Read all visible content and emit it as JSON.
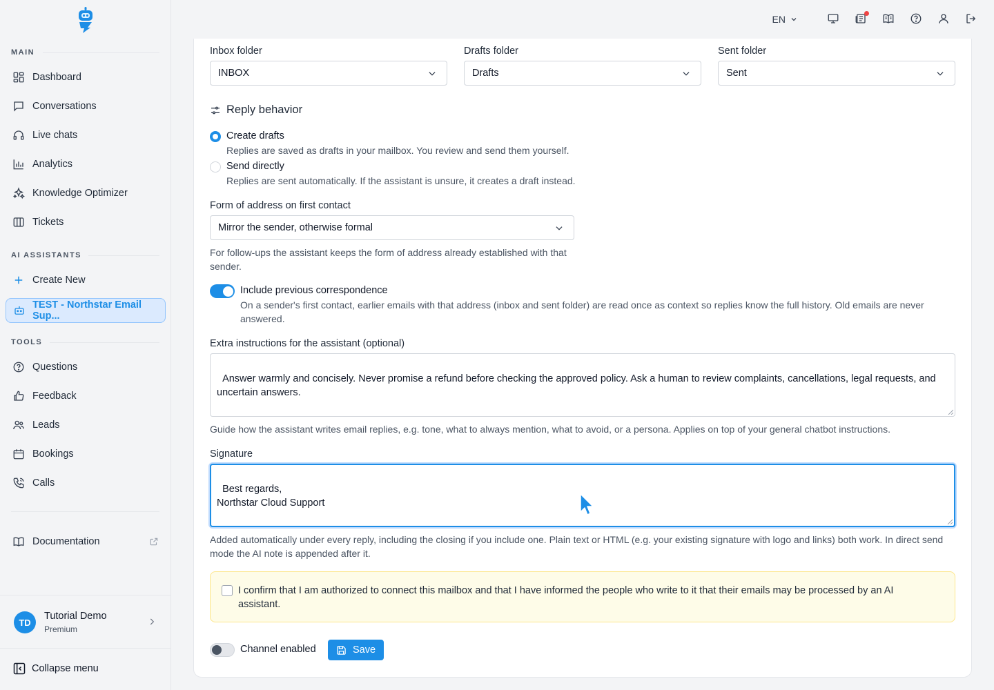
{
  "sidebar": {
    "main_label": "MAIN",
    "main_items": [
      {
        "label": "Dashboard",
        "icon": "dashboard-icon"
      },
      {
        "label": "Conversations",
        "icon": "chat-icon"
      },
      {
        "label": "Live chats",
        "icon": "headset-icon"
      },
      {
        "label": "Analytics",
        "icon": "bar-chart-icon"
      },
      {
        "label": "Knowledge Optimizer",
        "icon": "sparkles-icon"
      },
      {
        "label": "Tickets",
        "icon": "columns-icon"
      }
    ],
    "assistants_label": "AI ASSISTANTS",
    "create_new": "Create New",
    "active_assistant": "TEST - Northstar Email Sup...",
    "tools_label": "TOOLS",
    "tools_items": [
      {
        "label": "Questions",
        "icon": "question-icon"
      },
      {
        "label": "Feedback",
        "icon": "thumbs-up-icon"
      },
      {
        "label": "Leads",
        "icon": "users-icon"
      },
      {
        "label": "Bookings",
        "icon": "calendar-icon"
      },
      {
        "label": "Calls",
        "icon": "phone-icon"
      }
    ],
    "documentation": "Documentation",
    "user": {
      "initials": "TD",
      "name": "Tutorial Demo",
      "plan": "Premium"
    },
    "collapse": "Collapse menu"
  },
  "topbar": {
    "language": "EN"
  },
  "folders": {
    "inbox_label": "Inbox folder",
    "inbox_value": "INBOX",
    "drafts_label": "Drafts folder",
    "drafts_value": "Drafts",
    "sent_label": "Sent folder",
    "sent_value": "Sent"
  },
  "reply": {
    "heading": "Reply behavior",
    "options": [
      {
        "title": "Create drafts",
        "description": "Replies are saved as drafts in your mailbox. You review and send them yourself.",
        "checked": true
      },
      {
        "title": "Send directly",
        "description": "Replies are sent automatically. If the assistant is unsure, it creates a draft instead.",
        "checked": false
      }
    ]
  },
  "address": {
    "label": "Form of address on first contact",
    "value": "Mirror the sender, otherwise formal",
    "help": "For follow-ups the assistant keeps the form of address already established with that sender."
  },
  "correspondence": {
    "title": "Include previous correspondence",
    "description": "On a sender's first contact, earlier emails with that address (inbox and sent folder) are read once as context so replies know the full history. Old emails are never answered.",
    "enabled": true
  },
  "instructions": {
    "label": "Extra instructions for the assistant (optional)",
    "value": "Answer warmly and concisely. Never promise a refund before checking the approved policy. Ask a human to review complaints, cancellations, legal requests, and uncertain answers.",
    "help": "Guide how the assistant writes email replies, e.g. tone, what to always mention, what to avoid, or a persona. Applies on top of your general chatbot instructions."
  },
  "signature": {
    "label": "Signature",
    "value": "Best regards,\nNorthstar Cloud Support",
    "help": "Added automatically under every reply, including the closing if you include one. Plain text or HTML (e.g. your existing signature with logo and links) both work. In direct send mode the AI note is appended after it."
  },
  "consent": {
    "text": "I confirm that I am authorized to connect this mailbox and that I have informed the people who write to it that their emails may be processed by an AI assistant.",
    "checked": false
  },
  "footer": {
    "channel_label": "Channel enabled",
    "channel_enabled": false,
    "save_label": "Save"
  },
  "colors": {
    "accent": "#1d8ee6",
    "notice_bg": "#fefce8",
    "badge": "#ef4444"
  }
}
